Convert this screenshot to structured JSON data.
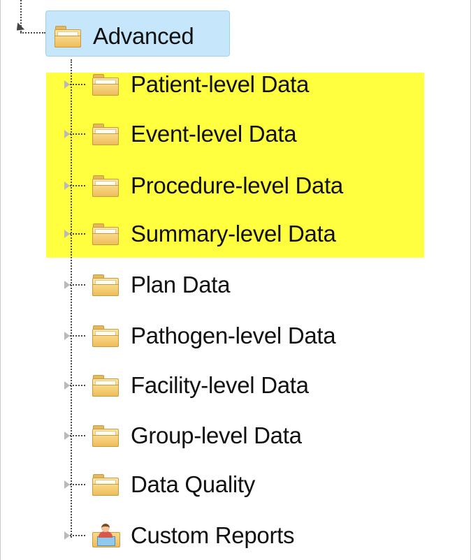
{
  "tree": {
    "root": {
      "label": "Advanced",
      "expanded": true,
      "selected": true,
      "icon": "folder-icon"
    },
    "children": [
      {
        "label": "Patient-level Data",
        "icon": "folder-icon",
        "highlighted": true
      },
      {
        "label": "Event-level Data",
        "icon": "folder-icon",
        "highlighted": true
      },
      {
        "label": "Procedure-level Data",
        "icon": "folder-icon",
        "highlighted": true
      },
      {
        "label": "Summary-level Data",
        "icon": "folder-icon",
        "highlighted": true
      },
      {
        "label": "Plan Data",
        "icon": "folder-icon",
        "highlighted": false
      },
      {
        "label": "Pathogen-level Data",
        "icon": "folder-icon",
        "highlighted": false
      },
      {
        "label": "Facility-level Data",
        "icon": "folder-icon",
        "highlighted": false
      },
      {
        "label": "Group-level Data",
        "icon": "folder-icon",
        "highlighted": false
      },
      {
        "label": "Data Quality",
        "icon": "folder-icon",
        "highlighted": false
      },
      {
        "label": "Custom Reports",
        "icon": "custom-report-icon",
        "highlighted": false
      }
    ]
  },
  "colors": {
    "selection": "#c6e6fb",
    "highlight": "#ffff40",
    "folder": "#f0c56a"
  }
}
